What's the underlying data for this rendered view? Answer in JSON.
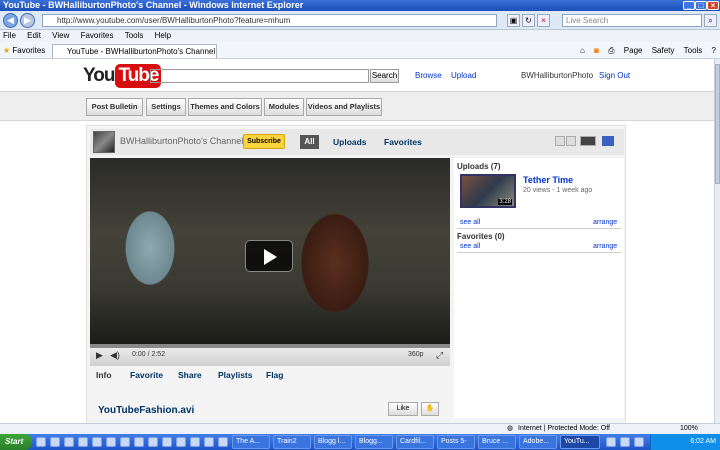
{
  "window": {
    "title": "YouTube - BWHalliburtonPhoto's Channel - Windows Internet Explorer"
  },
  "address": {
    "url": "http://www.youtube.com/user/BWHalliburtonPhoto?feature=mhum",
    "search_placeholder": "Live Search"
  },
  "menu": [
    "File",
    "Edit",
    "View",
    "Favorites",
    "Tools",
    "Help"
  ],
  "favorites": {
    "label": "Favorites",
    "tab_title": "YouTube - BWHalliburtonPhoto's Channel"
  },
  "ie_tools": [
    "Page",
    "Safety",
    "Tools"
  ],
  "yt": {
    "logo_you": "You",
    "logo_tube": "Tube",
    "search_button": "Search",
    "browse": "Browse",
    "upload": "Upload",
    "username": "BWHalliburtonPhoto",
    "signout": "Sign Out"
  },
  "editbar": [
    "Post Bulletin",
    "Settings",
    "Themes and Colors",
    "Modules",
    "Videos and Playlists"
  ],
  "channel": {
    "name": "BWHalliburtonPhoto's Channel",
    "subscribe": "Subscribe",
    "tabs": {
      "all": "All",
      "uploads": "Uploads",
      "favorites": "Favorites"
    }
  },
  "player": {
    "time": "0:00 / 2:52",
    "quality": "360p"
  },
  "infobar": [
    "Info",
    "Favorite",
    "Share",
    "Playlists",
    "Flag"
  ],
  "video": {
    "title": "YouTubeFashion.avi",
    "like": "Like"
  },
  "side": {
    "uploads_header": "Uploads (7)",
    "video_title": "Tether Time",
    "video_meta": "20 views - 1 week ago",
    "duration": "3:28",
    "see_all": "see all",
    "arrange": "arrange",
    "favorites_header": "Favorites (0)"
  },
  "status": {
    "zone": "Internet | Protected Mode: Off",
    "zoom": "100%"
  },
  "taskbar": {
    "start": "Start",
    "tasks": [
      "The A...",
      "Train2",
      "Blogg l...",
      "Blogg...",
      "Cardfil...",
      "Posts 5-",
      "Bruce ...",
      "Adobe...",
      "YouTu..."
    ],
    "clock": "6:02 AM"
  }
}
